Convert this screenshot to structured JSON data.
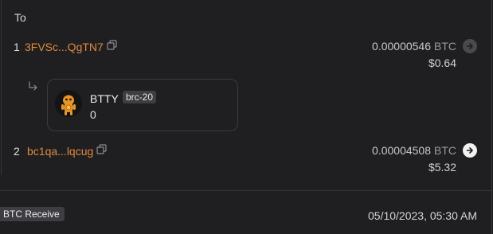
{
  "outputs": {
    "title": "To",
    "rows": [
      {
        "index": "1",
        "address": "3FVSc...QgTN7",
        "amount": "0.00000546",
        "unit": "BTC",
        "usd": "$0.64",
        "arrow_state": "disabled"
      },
      {
        "index": "2",
        "address": "bc1qa...lqcug",
        "amount": "0.00004508",
        "unit": "BTC",
        "usd": "$5.32",
        "arrow_state": "enabled"
      }
    ]
  },
  "inscription": {
    "name": "BTTY",
    "badge": "brc-20",
    "amount": "0"
  },
  "footer": {
    "type_label": "BTC Receive",
    "timestamp": "05/10/2023, 05:30 AM"
  },
  "colors": {
    "address": "#e0893b",
    "background": "#1f1f22"
  },
  "icons": [
    "copy-icon",
    "arrow-right-icon",
    "branch-arrow-icon"
  ]
}
